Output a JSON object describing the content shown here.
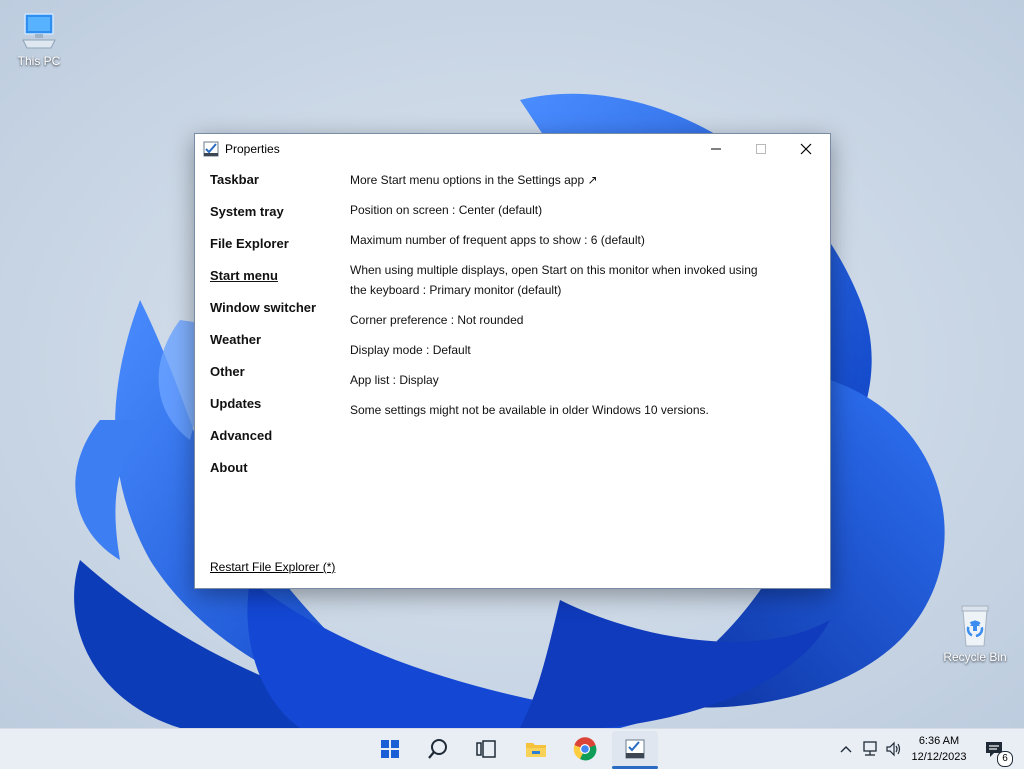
{
  "desktop": {
    "this_pc_label": "This PC",
    "recycle_bin_label": "Recycle Bin"
  },
  "window": {
    "title": "Properties",
    "nav": [
      {
        "label": "Taskbar"
      },
      {
        "label": "System tray"
      },
      {
        "label": "File Explorer"
      },
      {
        "label": "Start menu"
      },
      {
        "label": "Window switcher"
      },
      {
        "label": "Weather"
      },
      {
        "label": "Other"
      },
      {
        "label": "Updates"
      },
      {
        "label": "Advanced"
      },
      {
        "label": "About"
      }
    ],
    "active_nav": "Start menu",
    "restart_link": "Restart File Explorer (*)",
    "settings": {
      "more_options": "More Start menu options in the Settings app ↗",
      "position": "Position on screen : Center (default)",
      "max_frequent": "Maximum number of frequent apps to show : 6 (default)",
      "multi_display_line1": "When using multiple displays, open Start on this monitor when invoked using",
      "multi_display_line2": "the keyboard : Primary monitor (default)",
      "corner": "Corner preference : Not rounded",
      "display_mode": "Display mode : Default",
      "app_list": "App list : Display",
      "note": "Some settings might not be available in older Windows 10 versions."
    }
  },
  "taskbar": {
    "time": "6:36 AM",
    "date": "12/12/2023",
    "notification_count": "6",
    "icons": [
      "start-icon",
      "search-icon",
      "task-view-icon",
      "file-explorer-icon",
      "chrome-icon",
      "properties-app-icon"
    ]
  },
  "colors": {
    "accent": "#2a6cc4",
    "wallpaper_blue": "#1f5fe0",
    "wallpaper_bg": "#c9d6e4"
  }
}
